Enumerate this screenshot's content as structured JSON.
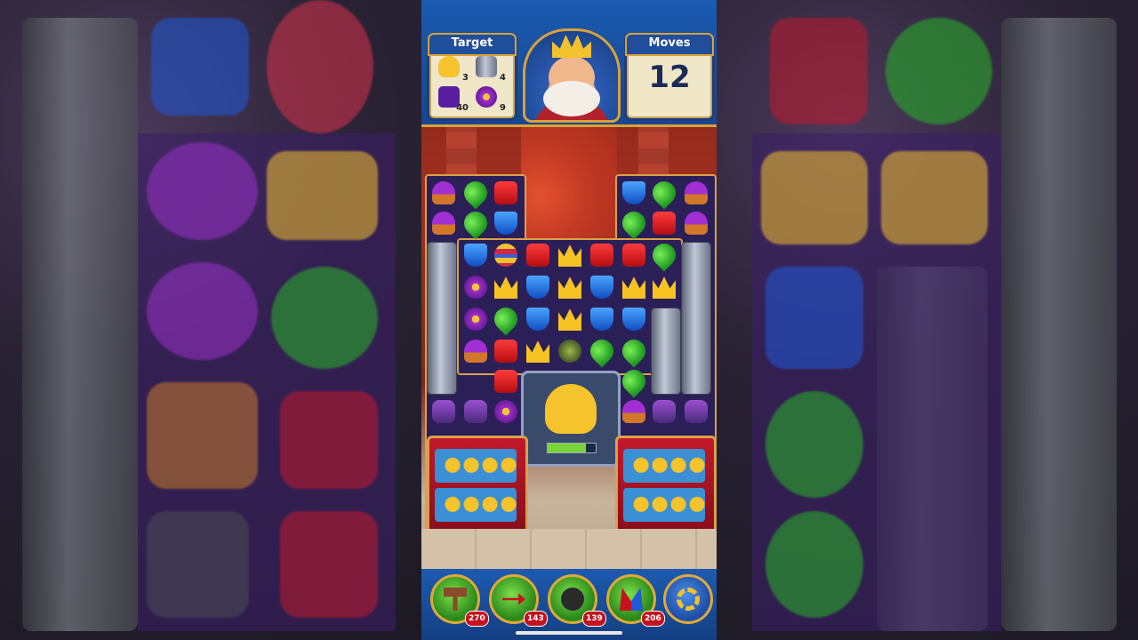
{
  "game": {
    "target_label": "Target",
    "moves_label": "Moves",
    "moves_left": "12",
    "targets": [
      {
        "icon": "duck-icon",
        "count": "3"
      },
      {
        "icon": "pillar-icon",
        "count": "4"
      },
      {
        "icon": "purple-carpet-icon",
        "count": "40"
      },
      {
        "icon": "flower-icon",
        "count": "9"
      }
    ]
  },
  "boosters": [
    {
      "name": "hammer-booster",
      "count": "270"
    },
    {
      "name": "arrow-booster",
      "count": "143"
    },
    {
      "name": "cannon-booster",
      "count": "139"
    },
    {
      "name": "jester-hat-booster",
      "count": "206"
    },
    {
      "name": "settings",
      "count": ""
    }
  ],
  "colors": {
    "accent_gold": "#d7a23b",
    "ui_blue": "#1b5ab0",
    "counter_red": "#c5121f"
  }
}
